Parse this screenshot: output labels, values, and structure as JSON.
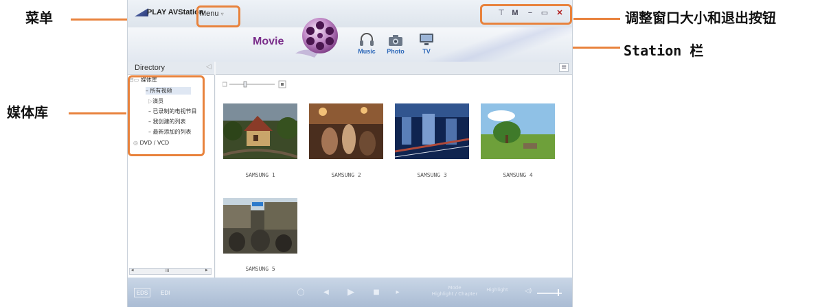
{
  "callouts": {
    "menu": "菜单",
    "library": "媒体库",
    "window_controls": "调整窗口大小和退出按钮",
    "station_bar": "Station 栏"
  },
  "titlebar": {
    "app_name": "PLAY AVStation",
    "menu_label": "Menu",
    "window_controls": [
      "⊤",
      "M",
      "−",
      "▭",
      "✕"
    ]
  },
  "station": {
    "current": "Movie",
    "items": [
      {
        "label": "Music",
        "icon": "headphones-icon"
      },
      {
        "label": "Photo",
        "icon": "camera-icon"
      },
      {
        "label": "TV",
        "icon": "tv-icon"
      }
    ]
  },
  "sidebar": {
    "header": "Directory",
    "root": "媒体库",
    "items": [
      "所有视频",
      "演员",
      "已录制的电视节目",
      "我创建的列表",
      "最新添加的列表"
    ],
    "dvd": "DVD / VCD",
    "scroll_label": "III"
  },
  "thumbnails": [
    {
      "label": "SAMSUNG 1"
    },
    {
      "label": "SAMSUNG 2"
    },
    {
      "label": "SAMSUNG 3"
    },
    {
      "label": "SAMSUNG 4"
    },
    {
      "label": "SAMSUNG 5"
    }
  ],
  "bottombar": {
    "eds_label": "EDS",
    "edi_label": "EDI",
    "mode_line1": "Mode",
    "mode_line2": "Highlight / Chapter",
    "highlight": "Highlight"
  },
  "colors": {
    "accent": "#e8823c",
    "movie_purple": "#7a2d8a",
    "station_blue": "#2a66b8"
  }
}
